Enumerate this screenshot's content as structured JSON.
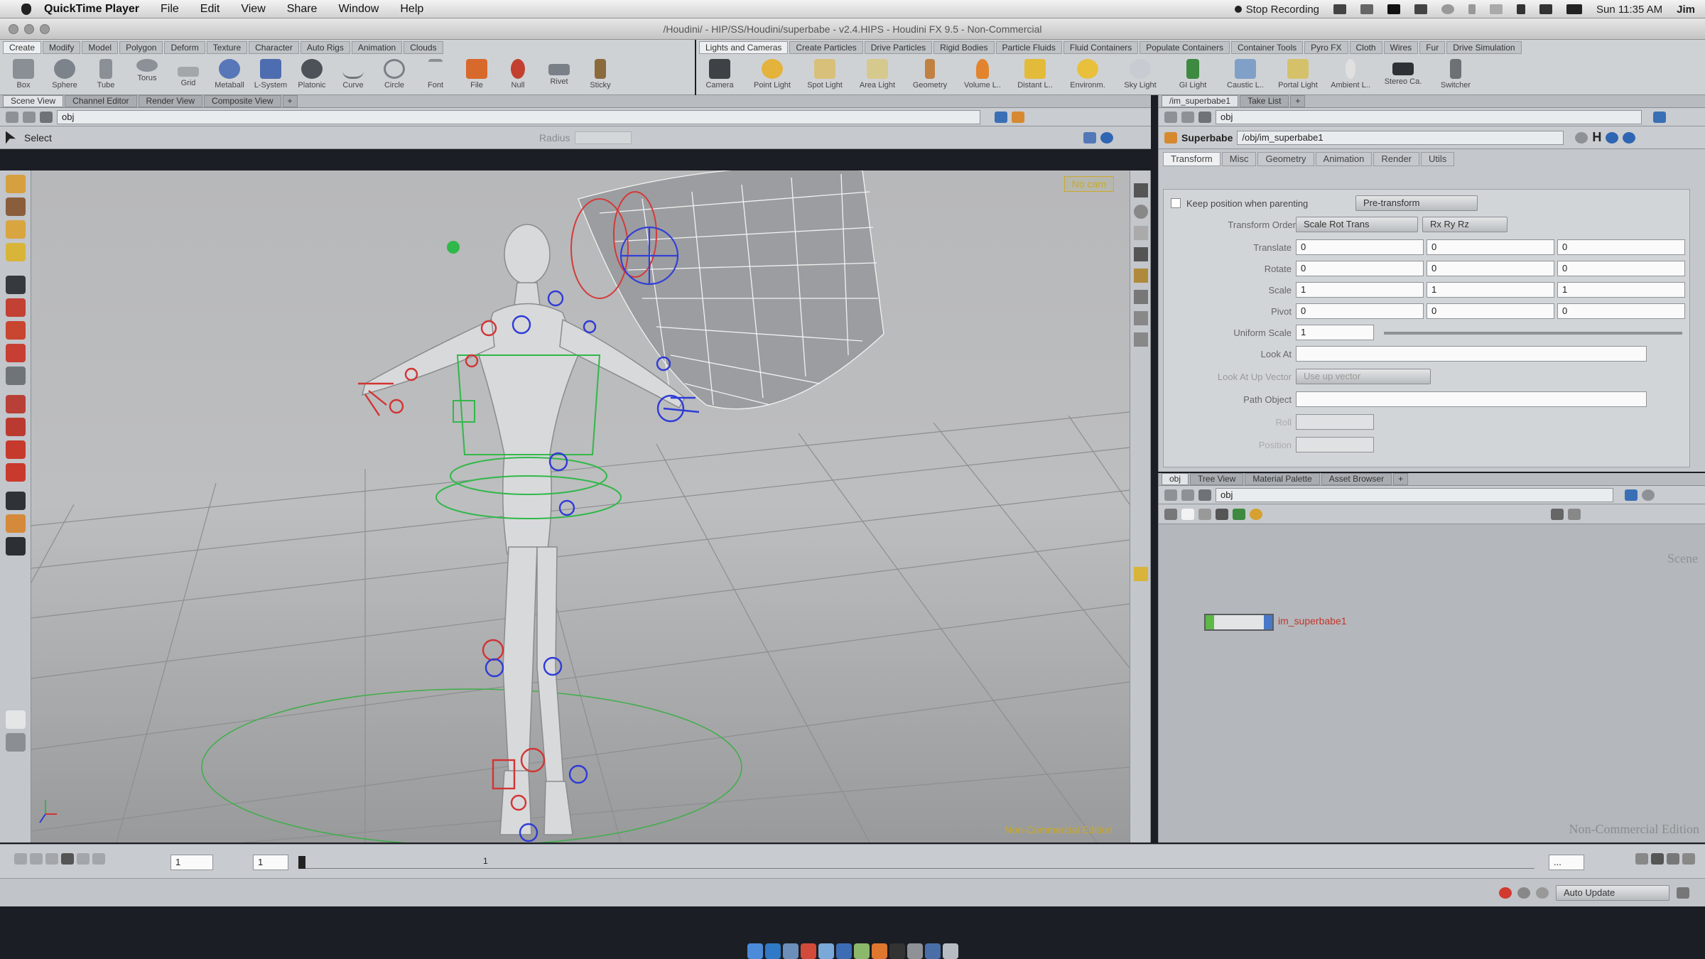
{
  "macos": {
    "apple_glyph": "",
    "app_name": "QuickTime Player",
    "menus": [
      "File",
      "Edit",
      "View",
      "Share",
      "Window",
      "Help"
    ],
    "recording": "Stop Recording",
    "clock": "Sun 11:35 AM",
    "user": "Jim"
  },
  "window": {
    "title": "/Houdini/ - HIP/SS/Houdini/superbabe - v2.4.HIPS - Houdini FX 9.5 - Non-Commercial"
  },
  "left_shelf": {
    "tabs": [
      "Create",
      "Modify",
      "Model",
      "Polygon",
      "Deform",
      "Texture",
      "Character",
      "Auto Rigs",
      "Animation",
      "Clouds"
    ],
    "tools": [
      {
        "label": "Box",
        "color": "#8a8f95"
      },
      {
        "label": "Sphere",
        "color": "#7d838a"
      },
      {
        "label": "Tube",
        "color": "#8b9096"
      },
      {
        "label": "Torus",
        "color": "#8c9197"
      },
      {
        "label": "Grid",
        "color": "#a3a7ab"
      },
      {
        "label": "Metaball",
        "color": "#5777b8"
      },
      {
        "label": "L-System",
        "color": "#4e6db0"
      },
      {
        "label": "Platonic",
        "color": "#4c5258"
      },
      {
        "label": "Curve",
        "color": "#6e767e"
      },
      {
        "label": "Circle",
        "color": "#7a8087"
      },
      {
        "label": "Font",
        "color": "#8a8f95"
      },
      {
        "label": "File",
        "color": "#d8692c"
      },
      {
        "label": "Null",
        "color": "#c2402f"
      },
      {
        "label": "Rivet",
        "color": "#7a8087"
      },
      {
        "label": "Sticky",
        "color": "#8b6a3c"
      }
    ]
  },
  "right_shelf": {
    "tabs": [
      "Lights and Cameras",
      "Create Particles",
      "Drive Particles",
      "Rigid Bodies",
      "Particle Fluids",
      "Fluid Containers",
      "Populate Containers",
      "Container Tools",
      "Pyro FX",
      "Cloth",
      "Wires",
      "Fur",
      "Drive Simulation"
    ],
    "tools": [
      {
        "label": "Camera",
        "color": "#3e4246"
      },
      {
        "label": "Point Light",
        "color": "#e3b33b"
      },
      {
        "label": "Spot Light",
        "color": "#d8c07a"
      },
      {
        "label": "Area Light",
        "color": "#d6c98d"
      },
      {
        "label": "Geometry",
        "color": "#c08142"
      },
      {
        "label": "Volume L..",
        "color": "#e2842e"
      },
      {
        "label": "Distant L..",
        "color": "#e3bb3a"
      },
      {
        "label": "Environm.",
        "color": "#e8c03c"
      },
      {
        "label": "Sky Light",
        "color": "#c8ccd2"
      },
      {
        "label": "GI Light",
        "color": "#3d8a40"
      },
      {
        "label": "Caustic L..",
        "color": "#80a0c8"
      },
      {
        "label": "Portal Light",
        "color": "#d6c16b"
      },
      {
        "label": "Ambient L..",
        "color": "#e0e0e0"
      },
      {
        "label": "Stereo Ca.",
        "color": "#2e3136"
      },
      {
        "label": "Switcher",
        "color": "#6c7176"
      }
    ]
  },
  "scene_view": {
    "tabs": [
      "Scene View",
      "Channel Editor",
      "Render View",
      "Composite View"
    ],
    "path": "obj",
    "tool_name": "Select",
    "radius_label": "Radius",
    "viewport_label": "No cam",
    "watermark": "Non-Commercial Edition"
  },
  "parameters": {
    "tabs": [
      "/im_superbabe1",
      "Take List"
    ],
    "path": "obj",
    "node_type": "Superbabe",
    "node_path": "/obj/im_superbabe1",
    "subtabs": [
      "Transform",
      "Misc",
      "Geometry",
      "Animation",
      "Render",
      "Utils"
    ],
    "keep_position": "Keep position when parenting",
    "pre_transform": "Pre-transform",
    "transform_order_label": "Transform Order",
    "transform_order": "Scale Rot Trans",
    "rotate_order": "Rx Ry Rz",
    "rows": [
      {
        "label": "Translate",
        "values": [
          "0",
          "0",
          "0"
        ]
      },
      {
        "label": "Rotate",
        "values": [
          "0",
          "0",
          "0"
        ]
      },
      {
        "label": "Scale",
        "values": [
          "1",
          "1",
          "1"
        ]
      },
      {
        "label": "Pivot",
        "values": [
          "0",
          "0",
          "0"
        ]
      }
    ],
    "uniform_scale_label": "Uniform Scale",
    "uniform_scale": "1",
    "look_at_label": "Look At",
    "look_at_up_label": "Look At Up Vector",
    "look_at_up": "Use up vector",
    "path_object_label": "Path Object",
    "roll_label": "Roll",
    "position_label": "Position"
  },
  "network": {
    "tabs": [
      "obj",
      "Tree View",
      "Material Palette",
      "Asset Browser"
    ],
    "path": "obj",
    "context_label": "Scene",
    "node_label": "im_superbabe1",
    "watermark": "Non-Commercial Edition"
  },
  "timeline": {
    "current_frame": "1",
    "start_frame": "1",
    "end_frame": "...",
    "ticks": [
      "1",
      "",
      "",
      "",
      "",
      ""
    ]
  },
  "status": {
    "auto_update": "Auto Update"
  }
}
